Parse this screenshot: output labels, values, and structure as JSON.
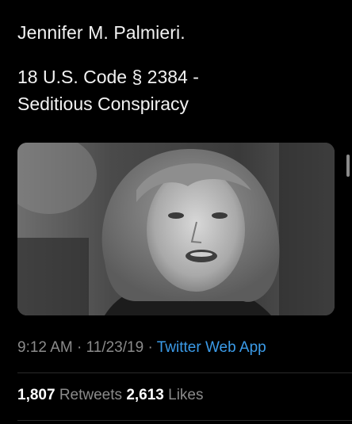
{
  "tweet": {
    "author_line": "Jennifer M. Palmieri.",
    "body_line1": "18 U.S. Code § 2384 -",
    "body_line2": "Seditious Conspiracy",
    "media_description_icon": "portrait-photo",
    "time": "9:12 AM",
    "separator": "·",
    "date": "11/23/19",
    "source": "Twitter Web App"
  },
  "stats": {
    "retweets_count": "1,807",
    "retweets_label": "Retweets",
    "likes_count": "2,613",
    "likes_label": "Likes"
  },
  "colors": {
    "background": "#000000",
    "text": "#f2f2f2",
    "muted": "#8b8b8b",
    "link": "#3b9be8"
  }
}
